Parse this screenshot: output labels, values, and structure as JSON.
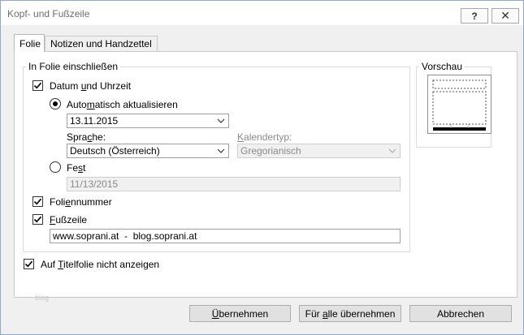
{
  "window": {
    "title": "Kopf- und Fußzeile",
    "help_label": "?",
    "close_label": "✕"
  },
  "tabs": [
    {
      "label": "Folie",
      "active": true
    },
    {
      "label": "Notizen und Handzettel",
      "active": false
    }
  ],
  "include_group": {
    "legend": "In Folie einschließen",
    "date_time": {
      "label_pre": "Datum ",
      "label_u": "u",
      "label_post": "nd Uhrzeit",
      "checked": true
    },
    "auto_update": {
      "label_pre": "Auto",
      "label_u": "m",
      "label_post": "atisch aktualisieren",
      "selected": true
    },
    "date_format": {
      "value": "13.11.2015"
    },
    "language": {
      "label_pre": "Spra",
      "label_u": "c",
      "label_post": "he:",
      "value": "Deutsch (Österreich)"
    },
    "calendar": {
      "label_u": "K",
      "label_post": "alendertyp:",
      "value": "Gregorianisch",
      "disabled": true
    },
    "fixed": {
      "label_pre": "Fe",
      "label_u": "s",
      "label_post": "t",
      "selected": false,
      "value": "11/13/2015"
    },
    "slide_number": {
      "label_pre": "Foli",
      "label_u": "e",
      "label_post": "nnummer",
      "checked": true
    },
    "footer": {
      "label_u": "F",
      "label_post": "ußzeile",
      "checked": true,
      "value": "www.soprani.at  -  blog.soprani.at"
    }
  },
  "dont_show_title": {
    "label_pre": "Auf ",
    "label_u": "T",
    "label_post": "itelfolie nicht anzeigen",
    "checked": true
  },
  "preview": {
    "legend": "Vorschau"
  },
  "watermark": "blog",
  "buttons": {
    "apply": {
      "label_u": "Ü",
      "label_post": "bernehmen"
    },
    "apply_all": {
      "label_pre": "Für ",
      "label_u": "a",
      "label_post": "lle übernehmen"
    },
    "cancel": {
      "label": "Abbrechen"
    }
  }
}
